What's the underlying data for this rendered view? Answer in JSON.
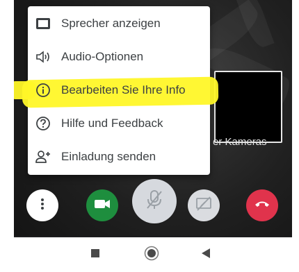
{
  "menu": {
    "items": [
      {
        "label": "Sprecher anzeigen",
        "icon": "speaker-view-icon"
      },
      {
        "label": "Audio-Optionen",
        "icon": "audio-options-icon"
      },
      {
        "label": "Bearbeiten Sie Ihre Info",
        "icon": "info-icon"
      },
      {
        "label": "Hilfe und Feedback",
        "icon": "help-icon"
      },
      {
        "label": "Einladung senden",
        "icon": "add-person-icon"
      }
    ],
    "highlight_color": "#fff728"
  },
  "video": {
    "camera_text": "er Kameras"
  },
  "controls": {
    "more_icon": "more-vertical-icon",
    "camera_icon": "videocam-icon",
    "mic_icon": "mic-off-icon",
    "present_icon": "present-screen-off-icon",
    "end_call_icon": "end-call-icon",
    "camera_color": "#1e8e3e",
    "end_call_color": "#e0334c"
  },
  "navbar": {
    "icons": [
      "recents-square-icon",
      "home-circle-icon",
      "back-triangle-icon"
    ]
  }
}
